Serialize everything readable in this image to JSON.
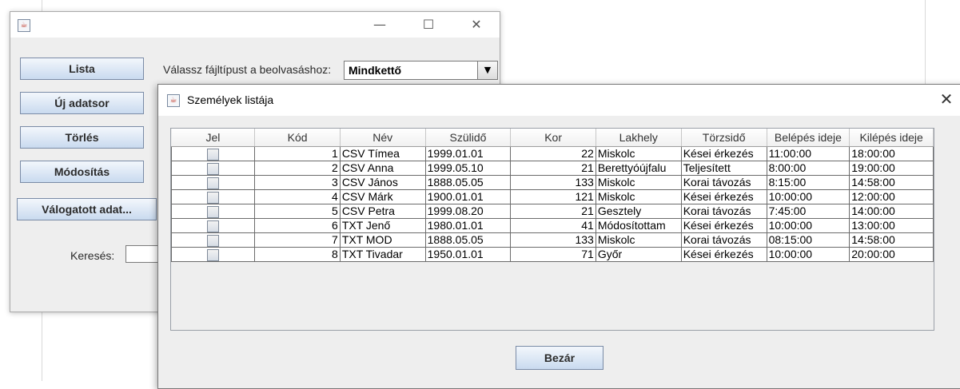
{
  "main_window": {
    "controls": {
      "minimize": "—",
      "maximize": "☐",
      "close": "✕"
    },
    "buttons": {
      "lista": "Lista",
      "uj_adatsor": "Új adatsor",
      "torles": "Törlés",
      "modositas": "Módosítás",
      "valogatott": "Válogatott adat..."
    },
    "filetype_label": "Válassz fájltípust a beolvasáshoz:",
    "filetype_selected": "Mindkettő",
    "search_label": "Keresés:",
    "search_value": ""
  },
  "dialog": {
    "title": "Személyek listája",
    "close_glyph": "✕",
    "close_button": "Bezár",
    "table": {
      "headers": [
        "Jel",
        "Kód",
        "Név",
        "Szülidő",
        "Kor",
        "Lakhely",
        "Törzsidő",
        "Belépés ideje",
        "Kilépés ideje"
      ],
      "rows": [
        [
          "",
          "1",
          "CSV Tímea",
          "1999.01.01",
          "22",
          "Miskolc",
          "Kései érkezés",
          "11:00:00",
          "18:00:00"
        ],
        [
          "",
          "2",
          "CSV Anna",
          "1999.05.10",
          "21",
          "Berettyóújfalu",
          "Teljesített",
          "8:00:00",
          "19:00:00"
        ],
        [
          "",
          "3",
          "CSV János",
          "1888.05.05",
          "133",
          "Miskolc",
          "Korai távozás",
          "8:15:00",
          "14:58:00"
        ],
        [
          "",
          "4",
          "CSV Márk",
          "1900.01.01",
          "121",
          "Miskolc",
          "Kései érkezés",
          "10:00:00",
          "12:00:00"
        ],
        [
          "",
          "5",
          "CSV Petra",
          "1999.08.20",
          "21",
          "Gesztely",
          "Korai távozás",
          "7:45:00",
          "14:00:00"
        ],
        [
          "",
          "6",
          "TXT Jenő",
          "1980.01.01",
          "41",
          "Módosítottam",
          "Kései érkezés",
          "10:00:00",
          "13:00:00"
        ],
        [
          "",
          "7",
          "TXT MOD",
          "1888.05.05",
          "133",
          "Miskolc",
          "Korai távozás",
          "08:15:00",
          "14:58:00"
        ],
        [
          "",
          "8",
          "TXT Tivadar",
          "1950.01.01",
          "71",
          "Győr",
          "Kései érkezés",
          "10:00:00",
          "20:00:00"
        ]
      ]
    }
  }
}
